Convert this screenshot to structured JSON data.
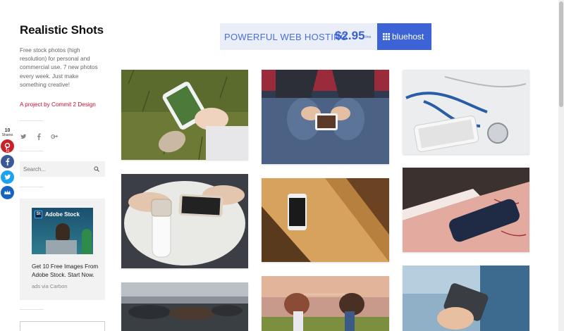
{
  "site": {
    "title": "Realistic Shots",
    "description": "Free stock photos (high resolution) for personal and commercial use. 7 new photos every week. Just make something creative!",
    "project_link": "A project by Commit 2 Design"
  },
  "social": [
    "twitter-icon",
    "facebook-icon",
    "google-plus-icon"
  ],
  "search": {
    "placeholder": "Search..."
  },
  "ad": {
    "brand": "Adobe Stock",
    "logo_letters": "St",
    "text": "Get 10 Free Images From Adobe Stock. Start Now.",
    "via": "ads via Carbon"
  },
  "share": {
    "count": "10",
    "label": "Shares",
    "pinterest_count": "10",
    "buttons": [
      {
        "name": "pinterest",
        "color": "#cb2027"
      },
      {
        "name": "facebook",
        "color": "#3b5998"
      },
      {
        "name": "twitter",
        "color": "#1da1f2"
      },
      {
        "name": "sumo",
        "color": "#1565c0"
      }
    ]
  },
  "banner": {
    "text": "POWERFUL WEB HOSTING",
    "price": "$2.95",
    "per": "/mo",
    "button_label": "bluehost"
  },
  "photos": [
    {
      "subject": "hand holding phone over autumn grass"
    },
    {
      "subject": "person in jeans using phone"
    },
    {
      "subject": "stethoscope and phone"
    },
    {
      "subject": "hands with phone and smartwatch"
    },
    {
      "subject": "phone on wooden table in sunlight"
    },
    {
      "subject": "dark phone on pink notebook"
    },
    {
      "subject": "people lying on car"
    },
    {
      "subject": "girls holding hands in field"
    },
    {
      "subject": "hand holding phone"
    }
  ],
  "colors": {
    "accent": "#c8102e",
    "banner_blue": "#3c64d6",
    "sidebar_bg": "#f2f2f2"
  }
}
